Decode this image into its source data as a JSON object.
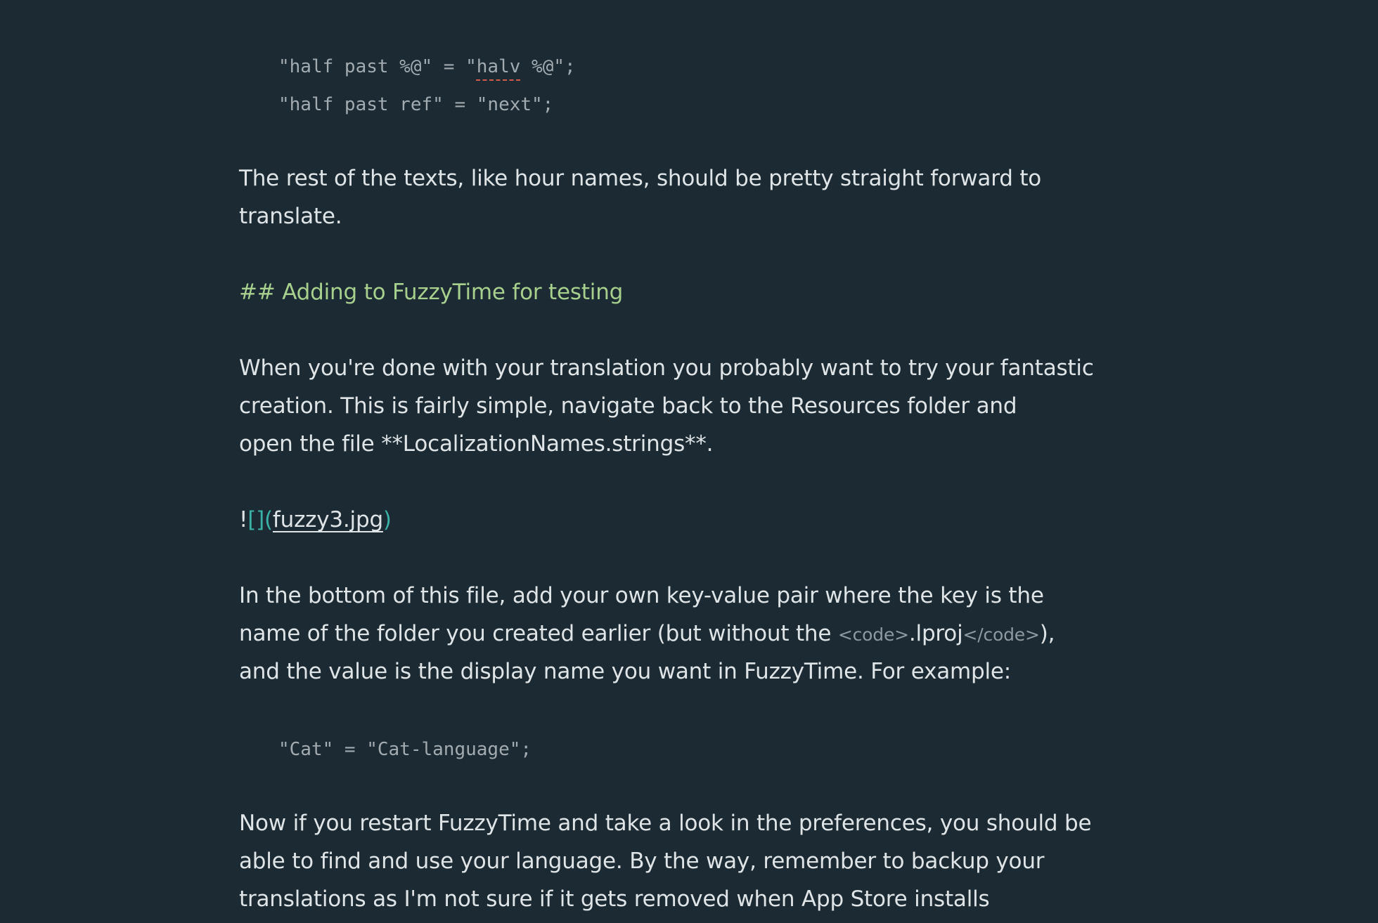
{
  "code_block_1": {
    "line_1": {
      "before": "\"half past %@\" = \"",
      "flagged": "halv",
      "after": " %@\";"
    },
    "line_2": "\"half past ref\" = \"next\";"
  },
  "paragraph_1": {
    "line_1": "The rest of the texts, like hour names, should be pretty straight forward to",
    "line_2": "translate."
  },
  "heading": "## Adding to FuzzyTime for testing",
  "paragraph_2": {
    "line_1": "When you're done with your translation you probably want to try your fantastic",
    "line_2": "creation. This is fairly simple, navigate back to the Resources folder and",
    "line_3": "open the file **LocalizationNames.strings**."
  },
  "image_link": {
    "bang": "!",
    "open_marks": "[](",
    "target": "fuzzy3.jpg",
    "close_mark": ")"
  },
  "paragraph_3": {
    "line_1": "In the bottom of this file, add your own key-value pair where the key is the",
    "line_2_before": "name of the folder you created earlier (but without the ",
    "code_open_tag": "<code>",
    "code_text": ".lproj",
    "code_close_tag": "</code>",
    "line_2_after": "),",
    "line_3": "and the value is the display name you want in FuzzyTime. For example:"
  },
  "code_block_2": "\"Cat\" = \"Cat-language\";",
  "paragraph_4": {
    "line_1": "Now if you restart FuzzyTime and take a look in the preferences, you should be",
    "line_2": "able to find and use your language. By the way, remember to backup your",
    "line_3": "translations as I'm not sure if it gets removed when App Store installs"
  }
}
